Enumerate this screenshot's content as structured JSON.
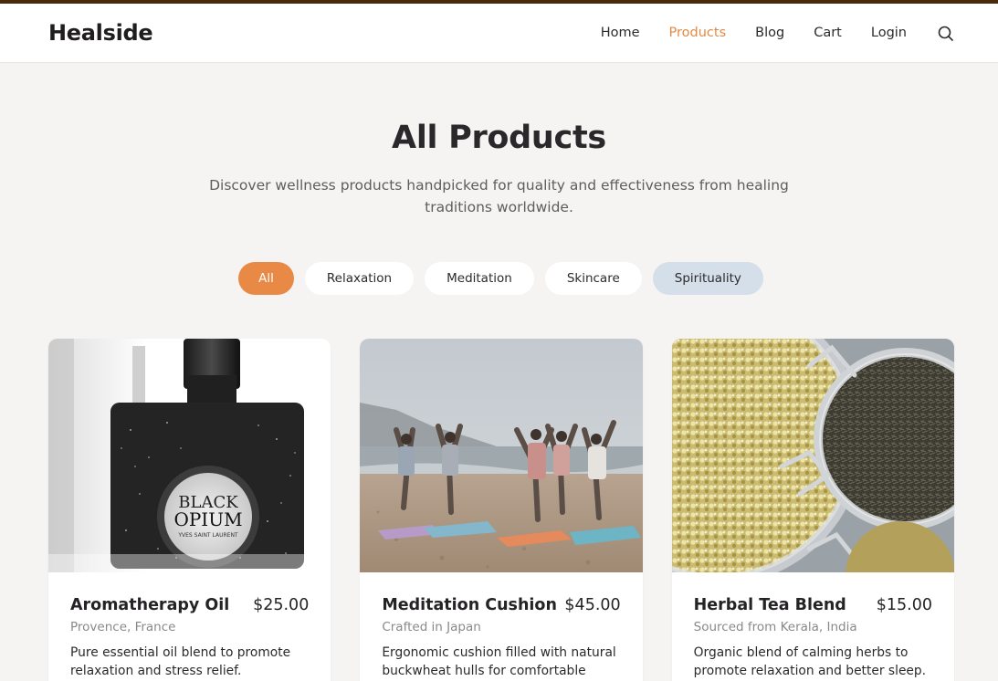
{
  "brand": "Healside",
  "nav": [
    {
      "label": "Home",
      "active": false
    },
    {
      "label": "Products",
      "active": true
    },
    {
      "label": "Blog",
      "active": false
    },
    {
      "label": "Cart",
      "active": false
    },
    {
      "label": "Login",
      "active": false
    }
  ],
  "search_icon": "search-icon",
  "hero": {
    "title": "All Products",
    "subtitle": "Discover wellness products handpicked for quality and effectiveness from healing traditions worldwide."
  },
  "filters": [
    "All",
    "Relaxation",
    "Meditation",
    "Skincare",
    "Spirituality"
  ],
  "products": [
    {
      "name": "Aromatherapy Oil",
      "price": "$25.00",
      "origin": "Provence, France",
      "description": "Pure essential oil blend to promote relaxation and stress relief.",
      "image": "perfume-bottle",
      "label_line1": "BLACK",
      "label_line2": "OPIUM",
      "label_line3": "YVES SAINT LAURENT"
    },
    {
      "name": "Meditation Cushion",
      "price": "$45.00",
      "origin": "Crafted in Japan",
      "description": "Ergonomic cushion filled with natural buckwheat hulls for comfortable",
      "image": "beach-yoga"
    },
    {
      "name": "Herbal Tea Blend",
      "price": "$15.00",
      "origin": "Sourced from Kerala, India",
      "description": "Organic blend of calming herbs to promote relaxation and better sleep.",
      "image": "tea-jars"
    }
  ],
  "colors": {
    "accent": "#e88a45",
    "topbar": "#4a2c0c",
    "hover_pill": "#d4dfe9",
    "background": "#f5f4f3"
  }
}
